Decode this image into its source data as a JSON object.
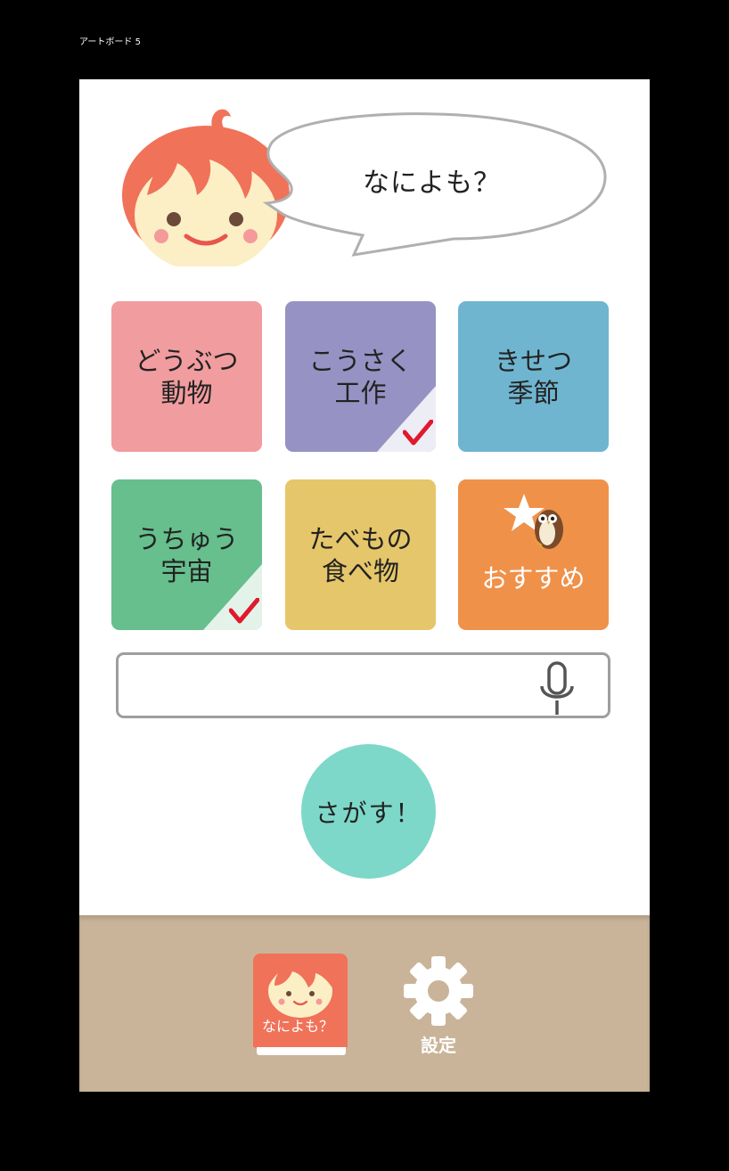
{
  "artboard_label": "アートボード 5",
  "header": {
    "bubble_text": "なによも？"
  },
  "tiles": [
    {
      "line1": "どうぶつ",
      "line2": "動物",
      "color": "#f19c9f",
      "checked": false
    },
    {
      "line1": "こうさく",
      "line2": "工作",
      "color": "#9692c3",
      "checked": true
    },
    {
      "line1": "きせつ",
      "line2": "季節",
      "color": "#6fb5cf",
      "checked": false
    },
    {
      "line1": "うちゅう",
      "line2": "宇宙",
      "color": "#66bf8d",
      "checked": true
    },
    {
      "line1": "たべもの",
      "line2": "食べ物",
      "color": "#e6c66a",
      "checked": false
    },
    {
      "line1": "おすすめ",
      "color": "#f0914a",
      "icons": [
        "star-icon",
        "owl-icon"
      ]
    }
  ],
  "search": {
    "value": "",
    "mic_icon": "microphone-icon"
  },
  "go_button": {
    "label": "さがす！"
  },
  "bottom_nav": {
    "home_label": "なによも？",
    "settings_label": "設定",
    "home_icon": "book-mascot-icon",
    "settings_icon": "gear-icon"
  },
  "colors": {
    "check": "#e0192c",
    "go": "#7dd8c9",
    "bottom_bar": "#c9b499",
    "mascot_hair": "#f07259",
    "mascot_face": "#fcefc6"
  }
}
